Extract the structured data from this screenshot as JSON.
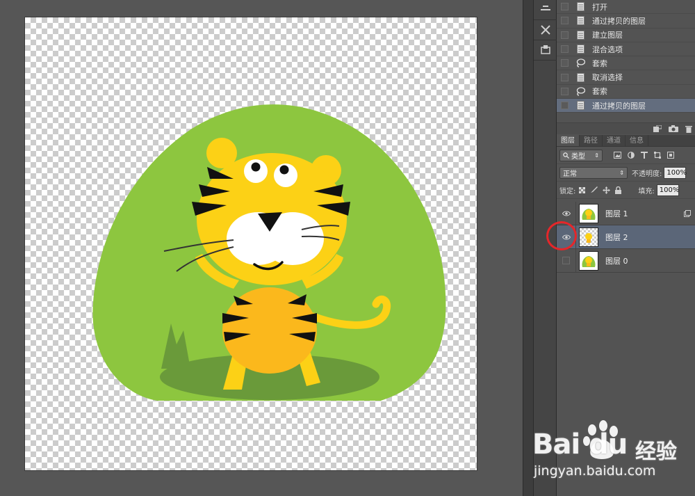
{
  "history": {
    "items": [
      {
        "label": "打开",
        "icon": "document-icon",
        "active": false
      },
      {
        "label": "通过拷贝的图层",
        "icon": "document-icon",
        "active": false
      },
      {
        "label": "建立图层",
        "icon": "document-icon",
        "active": false
      },
      {
        "label": "混合选项",
        "icon": "document-icon",
        "active": false
      },
      {
        "label": "套索",
        "icon": "lasso-icon",
        "active": false
      },
      {
        "label": "取消选择",
        "icon": "document-icon",
        "active": false
      },
      {
        "label": "套索",
        "icon": "lasso-icon",
        "active": false
      },
      {
        "label": "通过拷贝的图层",
        "icon": "document-icon",
        "active": true
      }
    ]
  },
  "layers_panel": {
    "tabs": [
      {
        "label": "图层",
        "active": true
      },
      {
        "label": "路径",
        "active": false
      },
      {
        "label": "通道",
        "active": false
      },
      {
        "label": "信息",
        "active": false
      }
    ],
    "filter_kind": "类型",
    "blend_mode": "正常",
    "opacity_label": "不透明度:",
    "opacity_value": "100%",
    "lock_label": "锁定:",
    "fill_label": "填充:",
    "fill_value": "100%",
    "layers": [
      {
        "name": "图层 1",
        "visible": true,
        "selected": false,
        "thumb": "tiger"
      },
      {
        "name": "图层 2",
        "visible": true,
        "selected": true,
        "thumb": "tiger-transparent"
      },
      {
        "name": "图层 0",
        "visible": false,
        "selected": false,
        "thumb": "tiger"
      }
    ]
  },
  "watermark": {
    "brand": "Bai du",
    "product": "经验",
    "url": "jingyan.baidu.com"
  },
  "colors": {
    "selection": "#5b6678",
    "annotation": "#e5262a",
    "artwork_green": "#8dc63f",
    "tiger_yellow": "#fcd116"
  }
}
